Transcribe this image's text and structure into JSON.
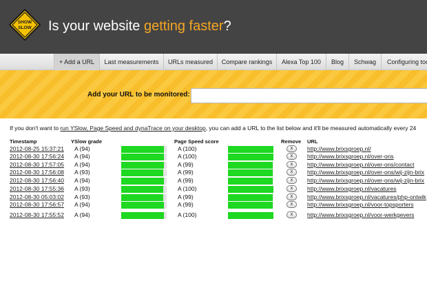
{
  "logo": {
    "line1": "SHOW",
    "line2": "SLOW"
  },
  "tagline": {
    "prefix": "Is your website ",
    "accent": "getting faster",
    "suffix": "?"
  },
  "colors": {
    "header_bg": "#444444",
    "accent": "#f6a623",
    "band": "#fbc940",
    "bar_fill": "#1ed821"
  },
  "nav": {
    "tabs": [
      {
        "label": "+ Add a URL"
      },
      {
        "label": "Last measurements"
      },
      {
        "label": "URLs measured"
      },
      {
        "label": "Compare rankings"
      },
      {
        "label": "Alexa Top 100"
      },
      {
        "label": "Blog"
      },
      {
        "label": "Schwag"
      },
      {
        "label": "Configuring too"
      }
    ]
  },
  "add_url": {
    "label": "Add your URL to be monitored:",
    "value": ""
  },
  "intro": {
    "before": "If you don't want to ",
    "link": "run YSlow, Page Speed and dynaTrace on your desktop",
    "after": ", you can add a URL to the list below and it'll be measured automatically every 24"
  },
  "table": {
    "headers": {
      "timestamp": "Timestamp",
      "yslow": "YSlow grade",
      "pagespeed": "Page Speed score",
      "remove": "Remove",
      "url": "URL"
    },
    "remove_label": "x",
    "rows": [
      {
        "timestamp": "2012-08-25 15:37:21",
        "yslow": "A (94)",
        "yslow_score": 94,
        "pagespeed": "A (100)",
        "pagespeed_score": 100,
        "url": "http://www.brixsgroep.nl/"
      },
      {
        "timestamp": "2012-08-30 17:56:24",
        "yslow": "A (94)",
        "yslow_score": 94,
        "pagespeed": "A (100)",
        "pagespeed_score": 100,
        "url": "http://www.brixsgroep.nl/over-ons"
      },
      {
        "timestamp": "2012-08-30 17:57:05",
        "yslow": "A (94)",
        "yslow_score": 94,
        "pagespeed": "A (99)",
        "pagespeed_score": 99,
        "url": "http://www.brixsgroep.nl/over-ons/contact"
      },
      {
        "timestamp": "2012-08-30 17:56:08",
        "yslow": "A (93)",
        "yslow_score": 93,
        "pagespeed": "A (99)",
        "pagespeed_score": 99,
        "url": "http://www.brixsgroep.nl/over-ons/wij-zijn-brix"
      },
      {
        "timestamp": "2012-08-30 17:56:40",
        "yslow": "A (94)",
        "yslow_score": 94,
        "pagespeed": "A (99)",
        "pagespeed_score": 99,
        "url": "http://www.brixsgroep.nl/over-ons/wij-zijn-brix"
      },
      {
        "timestamp": "2012-08-30 17:55:36",
        "yslow": "A (93)",
        "yslow_score": 93,
        "pagespeed": "A (100)",
        "pagespeed_score": 100,
        "url": "http://www.brixsgroep.nl/vacatures"
      },
      {
        "timestamp": "2012-08-30 05:03:02",
        "yslow": "A (93)",
        "yslow_score": 93,
        "pagespeed": "A (99)",
        "pagespeed_score": 99,
        "url": "http://www.brixsgroep.nl/vacatures/php-ontwik"
      },
      {
        "timestamp": "2012-08-30 17:56:57",
        "yslow": "A (94)",
        "yslow_score": 94,
        "pagespeed": "A (99)",
        "pagespeed_score": 99,
        "url": "http://www.brixsgroep.nl/voor-topsporters"
      },
      {
        "timestamp": "2012-08-30 17:55:52",
        "yslow": "A (94)",
        "yslow_score": 94,
        "pagespeed": "A (100)",
        "pagespeed_score": 100,
        "url": "http://www.brixsgroep.nl/voor-werkgevers"
      }
    ]
  }
}
